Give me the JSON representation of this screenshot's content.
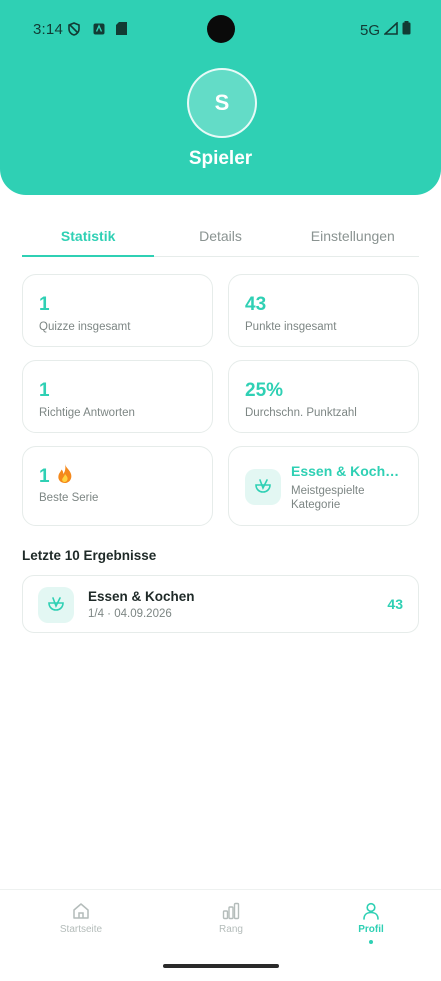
{
  "status_bar": {
    "time": "3:14",
    "network": "5G"
  },
  "profile": {
    "avatar_initial": "S",
    "name": "Spieler"
  },
  "tabs": [
    {
      "label": "Statistik",
      "active": true
    },
    {
      "label": "Details",
      "active": false
    },
    {
      "label": "Einstellungen",
      "active": false
    }
  ],
  "stats": {
    "total_quizzes": {
      "value": "1",
      "label": "Quizze insgesamt"
    },
    "total_points": {
      "value": "43",
      "label": "Punkte insgesamt"
    },
    "correct_answers": {
      "value": "1",
      "label": "Richtige Antworten"
    },
    "avg_score": {
      "value": "25%",
      "label": "Durchschn. Punktzahl"
    },
    "best_streak": {
      "value": "1",
      "label": "Beste Serie",
      "icon": "fire-icon"
    },
    "top_category": {
      "title": "Essen & Koch…",
      "label": "Meistgespielte Kategorie",
      "icon": "food-bowl-icon"
    }
  },
  "recent": {
    "title": "Letzte 10 Ergebnisse",
    "items": [
      {
        "title": "Essen & Kochen",
        "meta": "1/4 · 04.09.2026",
        "score": "43",
        "icon": "food-bowl-icon"
      }
    ]
  },
  "bottom_nav": [
    {
      "label": "Startseite",
      "icon": "home-icon",
      "active": false
    },
    {
      "label": "Rang",
      "icon": "bar-chart-icon",
      "active": false
    },
    {
      "label": "Profil",
      "icon": "user-icon",
      "active": true
    }
  ],
  "colors": {
    "accent": "#2fd0b4",
    "accent_light": "#e3f7f3",
    "muted": "#7d8684"
  }
}
